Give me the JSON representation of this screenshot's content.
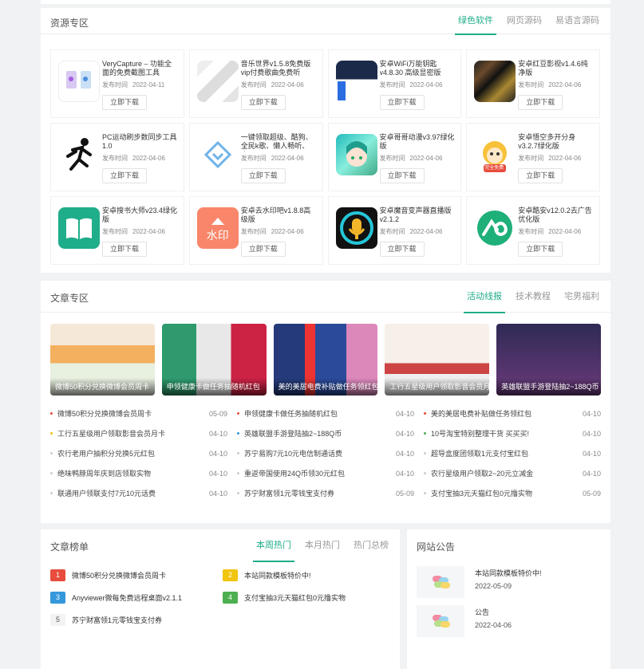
{
  "resources": {
    "title": "资源专区",
    "tabs": [
      "绿色软件",
      "网页源码",
      "易语言源码"
    ],
    "date_label": "发布时间",
    "download_label": "立即下载",
    "items": [
      {
        "title": "VeryCapture – 功能全面的免费截图工具",
        "date": "2022-04-11"
      },
      {
        "title": "音乐世界v1.5.8免费版 vip付费歌曲免费听",
        "date": "2022-04-06"
      },
      {
        "title": "安卓WiFi万能钥匙v4.8.30 高级显密版",
        "date": "2022-04-06"
      },
      {
        "title": "安卓红豆影视v1.4.6纯净版",
        "date": "2022-04-06"
      },
      {
        "title": "PC运动刷步数同步工具 1.0",
        "date": "2022-04-06"
      },
      {
        "title": "一键领取超级、酷狗、全民k歌、懒人畅听、喜...",
        "date": "2022-04-06"
      },
      {
        "title": "安卓哥哥动漫v3.97绿化版",
        "date": "2022-04-06"
      },
      {
        "title": "安卓悟空多开分身v3.2.7绿化版",
        "date": "2022-04-06"
      },
      {
        "title": "安卓搜书大师v23.4绿化版",
        "date": "2022-04-06"
      },
      {
        "title": "安卓去水印吧v1.8.8高级版",
        "date": "2022-04-06"
      },
      {
        "title": "安卓魔音变声器直播版v2.1.2",
        "date": "2022-04-06"
      },
      {
        "title": "安卓酷安v12.0.2去广告优化版",
        "date": "2022-04-06"
      }
    ],
    "badge_wukong": "完全免费",
    "badge_watermark": "水印"
  },
  "articles": {
    "title": "文章专区",
    "tabs": [
      "活动线报",
      "技术教程",
      "宅男福利"
    ],
    "featured": [
      "微博50积分兑换微博会员周卡",
      "申领健康卡做任务抽随机红包",
      "美的美居电费补贴做任务领红包",
      "工行五星级用户领取影音会员月卡",
      "英雄联盟手游登陆抽2~188Q币"
    ],
    "list": [
      {
        "text": "微博50积分兑换微博会员周卡",
        "date": "05-09",
        "dot": "#e74c3c"
      },
      {
        "text": "申领健康卡做任务抽随机红包",
        "date": "04-10",
        "dot": "#e74c3c"
      },
      {
        "text": "美的美居电费补贴做任务领红包",
        "date": "04-10",
        "dot": "#e74c3c"
      },
      {
        "text": "工行五星级用户领取影音会员月卡",
        "date": "04-10",
        "dot": "#f1c40f"
      },
      {
        "text": "英雄联盟手游登陆抽2~188Q币",
        "date": "04-10",
        "dot": "#3498db"
      },
      {
        "text": "10号淘宝特别整理干货 买买买!",
        "date": "04-10",
        "dot": "#4caf50"
      },
      {
        "text": "农行老用户抽积分兑换5元红包",
        "date": "04-10",
        "dot": "#cccccc"
      },
      {
        "text": "苏宁易购7元10元电信制通话费",
        "date": "04-10",
        "dot": "#cccccc"
      },
      {
        "text": "超导盒度团领取1元支付宝红包",
        "date": "04-10",
        "dot": "#cccccc"
      },
      {
        "text": "绝味鸭脖周年庆到店领取实物",
        "date": "04-10",
        "dot": "#cccccc"
      },
      {
        "text": "重返帝国使用24Q币领30元红包",
        "date": "04-10",
        "dot": "#cccccc"
      },
      {
        "text": "农行星级用户领取2~20元立减金",
        "date": "04-10",
        "dot": "#cccccc"
      },
      {
        "text": "联通用户领联支付7元10元话费",
        "date": "04-10",
        "dot": "#cccccc"
      },
      {
        "text": "苏宁财富领1元零钱宝支付券",
        "date": "05-09",
        "dot": "#cccccc"
      },
      {
        "text": "支付宝抽3元天猫红包0元撸实物",
        "date": "05-09",
        "dot": "#cccccc"
      }
    ]
  },
  "ranking": {
    "title": "文章榜单",
    "tabs": [
      "本周热门",
      "本月热门",
      "热门总榜"
    ],
    "items": [
      {
        "num": "1",
        "text": "微博50积分兑换微博会员周卡"
      },
      {
        "num": "2",
        "text": "本站同款模板特价中!"
      },
      {
        "num": "3",
        "text": "Anyviewer微每免费远程桌面v2.1.1"
      },
      {
        "num": "4",
        "text": "支付宝抽3元天猫红包0元撸实物"
      },
      {
        "num": "5",
        "text": "苏宁财富领1元零钱宝支付券"
      }
    ]
  },
  "notices": {
    "title": "网站公告",
    "items": [
      {
        "title": "本站同款模板特价中!",
        "date": "2022-05-09"
      },
      {
        "title": "公告",
        "date": "2022-04-06"
      }
    ]
  },
  "colors": {
    "accent": "#1fad8a"
  }
}
